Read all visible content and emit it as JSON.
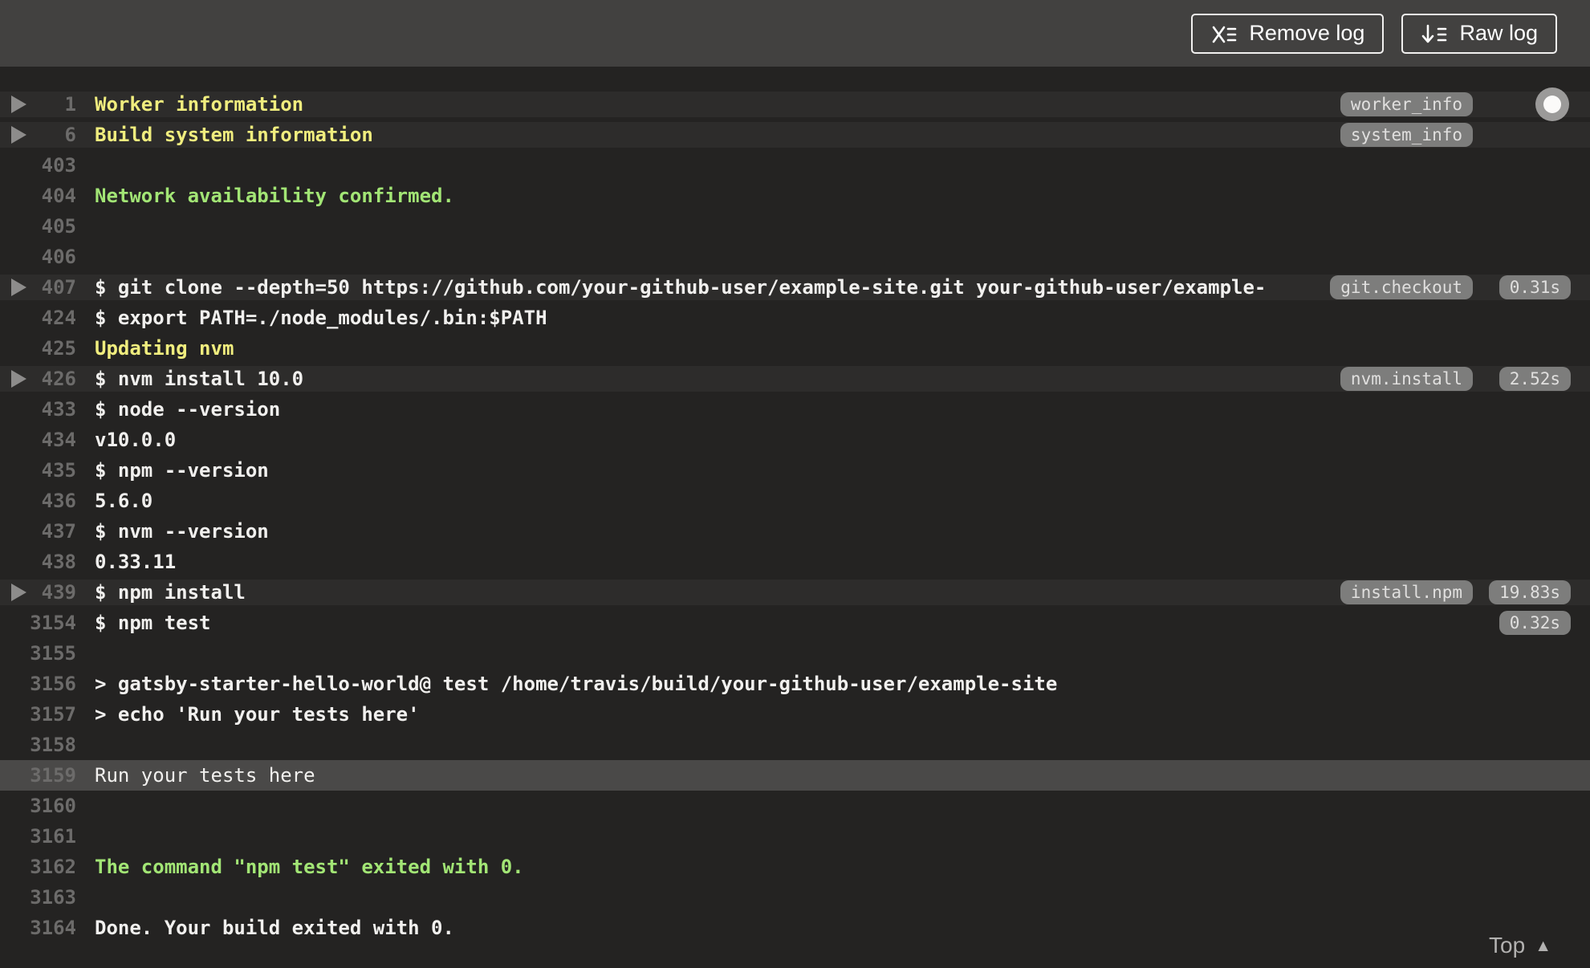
{
  "toolbar": {
    "remove_log_label": "Remove log",
    "raw_log_label": "Raw log",
    "icons": {
      "remove_log_icon": "x-with-list-lines",
      "raw_log_icon": "down-arrow-with-list-lines"
    }
  },
  "log": {
    "fold_icon": "triangle-right",
    "lines": [
      {
        "num": "1",
        "text": "Worker information",
        "style": "yellow",
        "fold": true,
        "tag": "worker_info"
      },
      {
        "num": "6",
        "text": "Build system information",
        "style": "yellow",
        "fold": true,
        "tag": "system_info"
      },
      {
        "num": "403",
        "text": ""
      },
      {
        "num": "404",
        "text": "Network availability confirmed.",
        "style": "green"
      },
      {
        "num": "405",
        "text": ""
      },
      {
        "num": "406",
        "text": ""
      },
      {
        "num": "407",
        "text": "$ git clone --depth=50 https://github.com/your-github-user/example-site.git your-github-user/example-",
        "fold": true,
        "tag": "git.checkout",
        "duration": "0.31s"
      },
      {
        "num": "424",
        "text": "$ export PATH=./node_modules/.bin:$PATH"
      },
      {
        "num": "425",
        "text": "Updating nvm",
        "style": "yellow"
      },
      {
        "num": "426",
        "text": "$ nvm install 10.0",
        "fold": true,
        "tag": "nvm.install",
        "duration": "2.52s"
      },
      {
        "num": "433",
        "text": "$ node --version"
      },
      {
        "num": "434",
        "text": "v10.0.0"
      },
      {
        "num": "435",
        "text": "$ npm --version"
      },
      {
        "num": "436",
        "text": "5.6.0"
      },
      {
        "num": "437",
        "text": "$ nvm --version"
      },
      {
        "num": "438",
        "text": "0.33.11"
      },
      {
        "num": "439",
        "text": "$ npm install",
        "fold": true,
        "tag": "install.npm",
        "duration": "19.83s"
      },
      {
        "num": "3154",
        "text": "$ npm test",
        "duration": "0.32s"
      },
      {
        "num": "3155",
        "text": ""
      },
      {
        "num": "3156",
        "text": "> gatsby-starter-hello-world@ test /home/travis/build/your-github-user/example-site"
      },
      {
        "num": "3157",
        "text": "> echo 'Run your tests here'"
      },
      {
        "num": "3158",
        "text": ""
      },
      {
        "num": "3159",
        "text": "Run your tests here",
        "highlighted": true,
        "weight": "regular"
      },
      {
        "num": "3160",
        "text": ""
      },
      {
        "num": "3161",
        "text": ""
      },
      {
        "num": "3162",
        "text": "The command \"npm test\" exited with 0.",
        "style": "green"
      },
      {
        "num": "3163",
        "text": ""
      },
      {
        "num": "3164",
        "text": "Done. Your build exited with 0."
      }
    ]
  },
  "footer": {
    "top_label": "Top",
    "top_icon": "▲"
  },
  "colors": {
    "header_bg": "#424140",
    "log_bg": "#242322",
    "fold_row_bg": "#2d2c2b",
    "highlight_row_bg": "#4a4948",
    "yellow_text": "#f0ed7e",
    "green_text": "#a2e575",
    "plain_text": "#f1f0ee",
    "line_number": "#6c6b6a",
    "pill_bg": "#7d7d7c",
    "pill_text": "#e0dfde"
  }
}
